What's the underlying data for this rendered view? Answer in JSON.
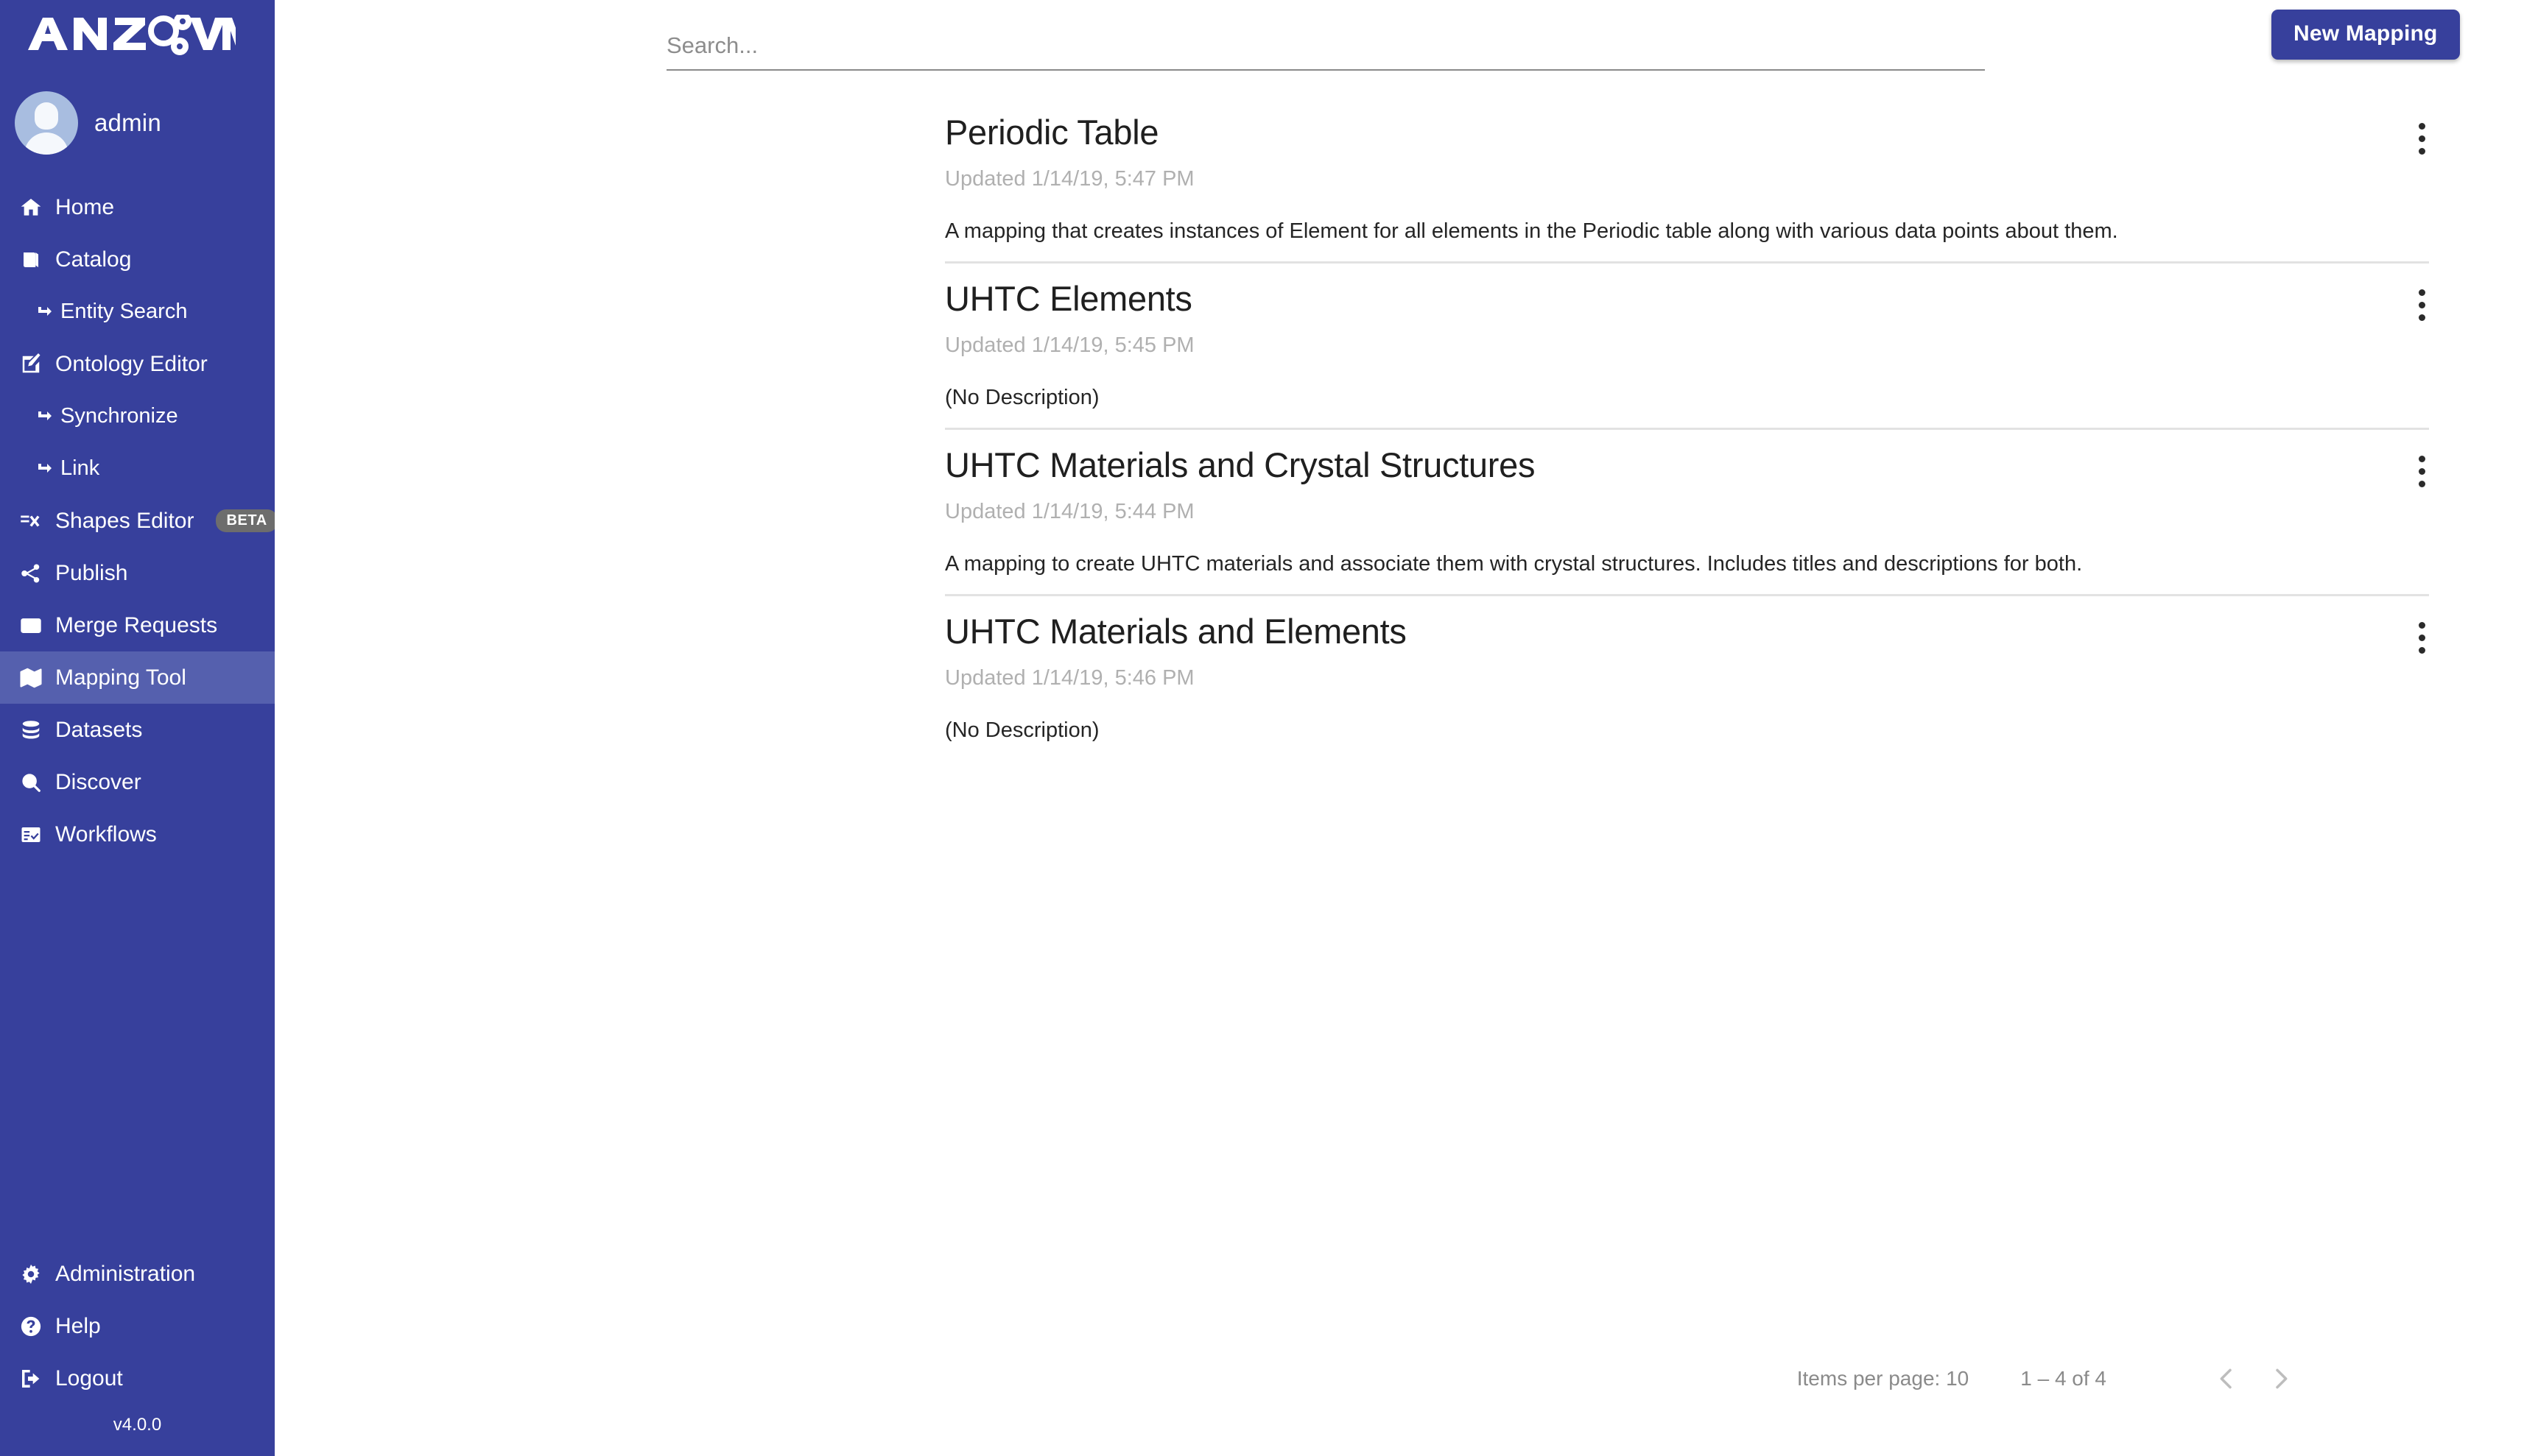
{
  "brand": {
    "name": "ANZO VM",
    "logo_icon": "anzo-vm-logo"
  },
  "user": {
    "name": "admin",
    "avatar_icon": "user-avatar-icon"
  },
  "sidebar": {
    "items": [
      {
        "label": "Home",
        "icon": "home-icon",
        "sub": false,
        "active": false
      },
      {
        "label": "Catalog",
        "icon": "book-icon",
        "sub": false,
        "active": false
      },
      {
        "label": "Entity Search",
        "icon": "arrow-sub-icon",
        "sub": true,
        "active": false
      },
      {
        "label": "Ontology Editor",
        "icon": "edit-square-icon",
        "sub": false,
        "active": false
      },
      {
        "label": "Synchronize",
        "icon": "arrow-sub-icon",
        "sub": true,
        "active": false
      },
      {
        "label": "Link",
        "icon": "arrow-sub-icon",
        "sub": true,
        "active": false
      },
      {
        "label": "Shapes Editor",
        "icon": "shapes-icon",
        "sub": false,
        "active": false,
        "badge": "BETA"
      },
      {
        "label": "Publish",
        "icon": "share-icon",
        "sub": false,
        "active": false
      },
      {
        "label": "Merge Requests",
        "icon": "envelope-icon",
        "sub": false,
        "active": false
      },
      {
        "label": "Mapping Tool",
        "icon": "map-icon",
        "sub": false,
        "active": true
      },
      {
        "label": "Datasets",
        "icon": "database-icon",
        "sub": false,
        "active": false
      },
      {
        "label": "Discover",
        "icon": "search-icon",
        "sub": false,
        "active": false
      },
      {
        "label": "Workflows",
        "icon": "workflow-icon",
        "sub": false,
        "active": false
      }
    ],
    "bottom_items": [
      {
        "label": "Administration",
        "icon": "gear-icon"
      },
      {
        "label": "Help",
        "icon": "question-circle-icon"
      },
      {
        "label": "Logout",
        "icon": "logout-icon"
      }
    ],
    "version": "v4.0.0",
    "background_color": "#37409c",
    "active_color": "#5560ae"
  },
  "toolbar": {
    "search_placeholder": "Search...",
    "search_value": "",
    "new_mapping_label": "New Mapping",
    "new_mapping_color": "#37409c"
  },
  "mappings": [
    {
      "title": "Periodic Table",
      "updated": "Updated 1/14/19, 5:47 PM",
      "description": "A mapping that creates instances of Element for all elements in the Periodic table along with various data points about them."
    },
    {
      "title": "UHTC Elements",
      "updated": "Updated 1/14/19, 5:45 PM",
      "description": "(No Description)"
    },
    {
      "title": "UHTC Materials and Crystal Structures",
      "updated": "Updated 1/14/19, 5:44 PM",
      "description": "A mapping to create UHTC materials and associate them with crystal structures. Includes titles and descriptions for both."
    },
    {
      "title": "UHTC Materials and Elements",
      "updated": "Updated 1/14/19, 5:46 PM",
      "description": "(No Description)"
    }
  ],
  "row_menu_icon": "kebab-menu-icon",
  "paginator": {
    "items_per_page_label": "Items per page: 10",
    "range_label": "1 – 4 of 4",
    "prev_icon": "chevron-left-icon",
    "next_icon": "chevron-right-icon"
  }
}
